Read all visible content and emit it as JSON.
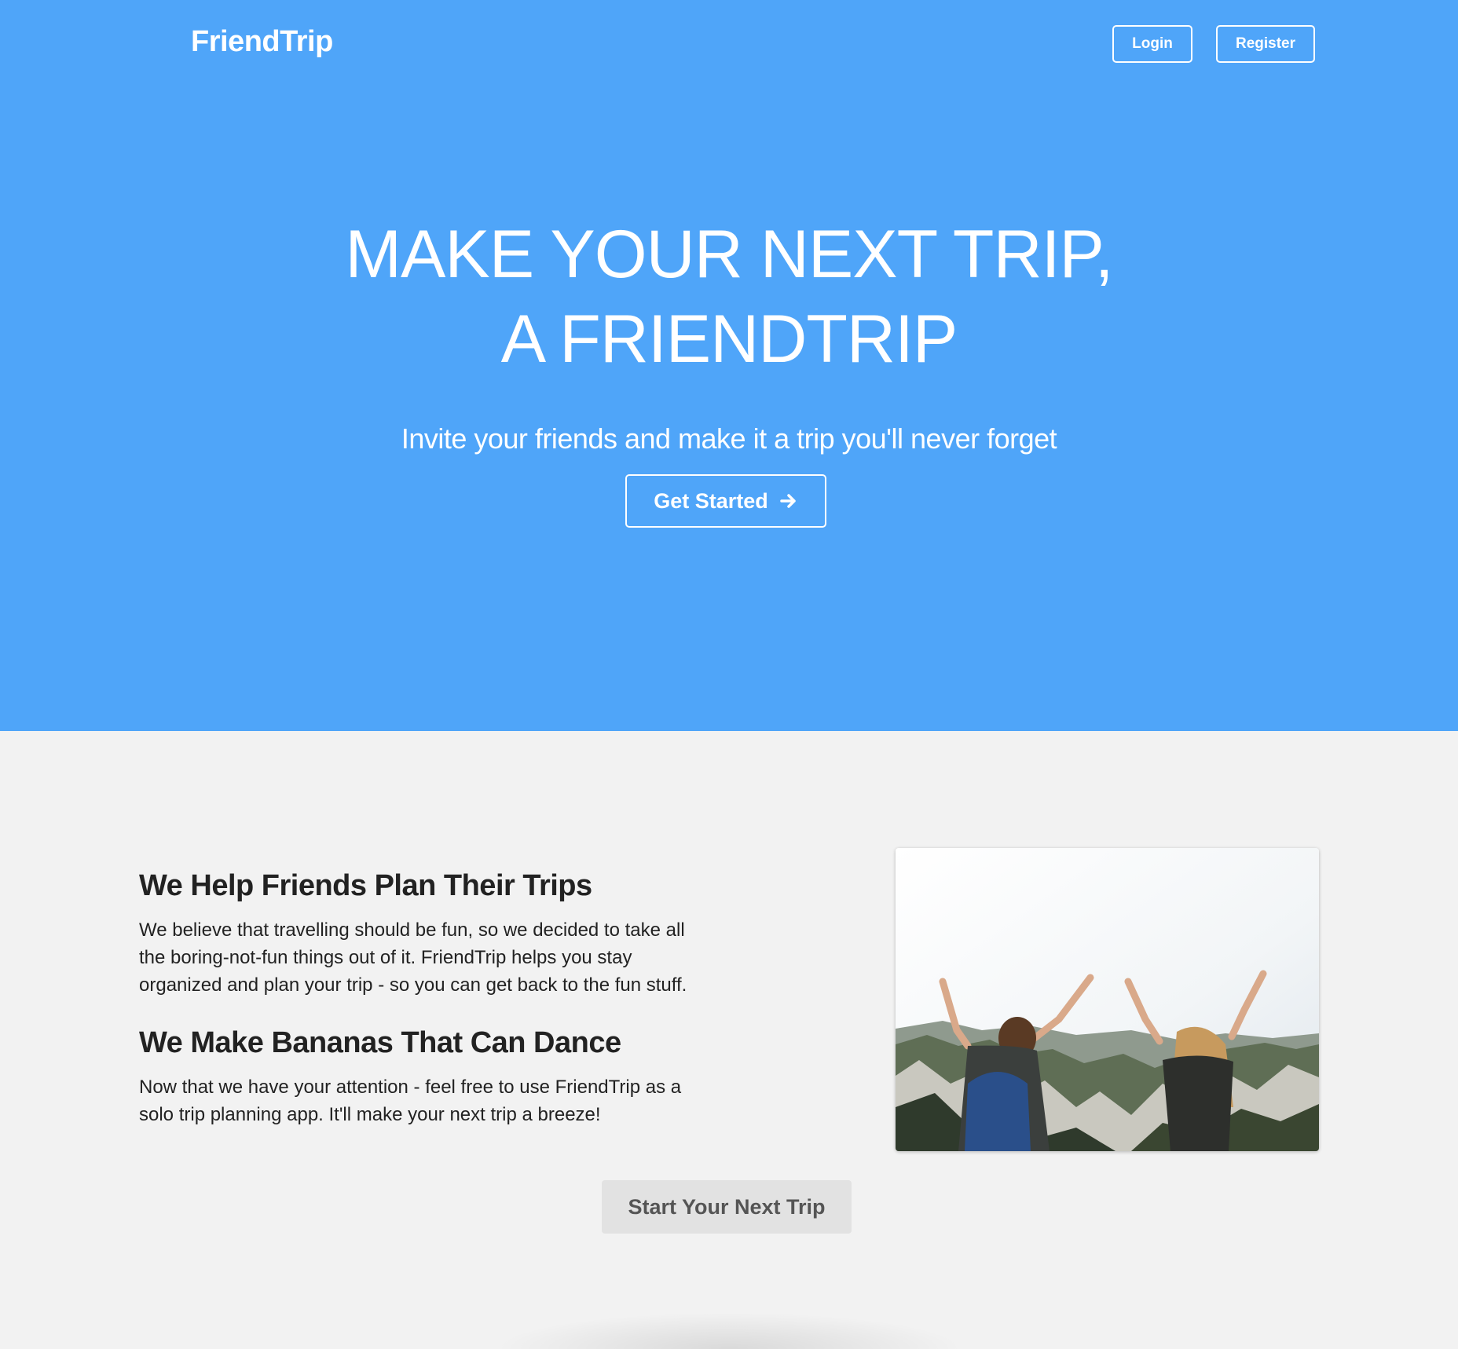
{
  "header": {
    "brand": "FriendTrip",
    "login_label": "Login",
    "register_label": "Register"
  },
  "hero": {
    "title": "MAKE YOUR NEXT TRIP, A FRIENDTRIP",
    "subtitle": "Invite your friends and make it a trip you'll never forget",
    "cta_label": "Get Started",
    "cta_icon": "arrow-right-icon"
  },
  "features": {
    "items": [
      {
        "heading": "We Help Friends Plan Their Trips",
        "text": "We believe that travelling should be fun, so we decided to take all the boring-not-fun things out of it. FriendTrip helps you stay organized and plan your trip - so you can get back to the fun stuff."
      },
      {
        "heading": "We Make Bananas That Can Dance",
        "text": "Now that we have your attention - feel free to use FriendTrip as a solo trip planning app. It'll make your next trip a breeze!"
      }
    ],
    "cta_label": "Start Your Next Trip"
  },
  "colors": {
    "hero_bg": "#4fa5f9",
    "section_bg": "#f2f2f2",
    "button_gray": "#e2e2e2"
  }
}
